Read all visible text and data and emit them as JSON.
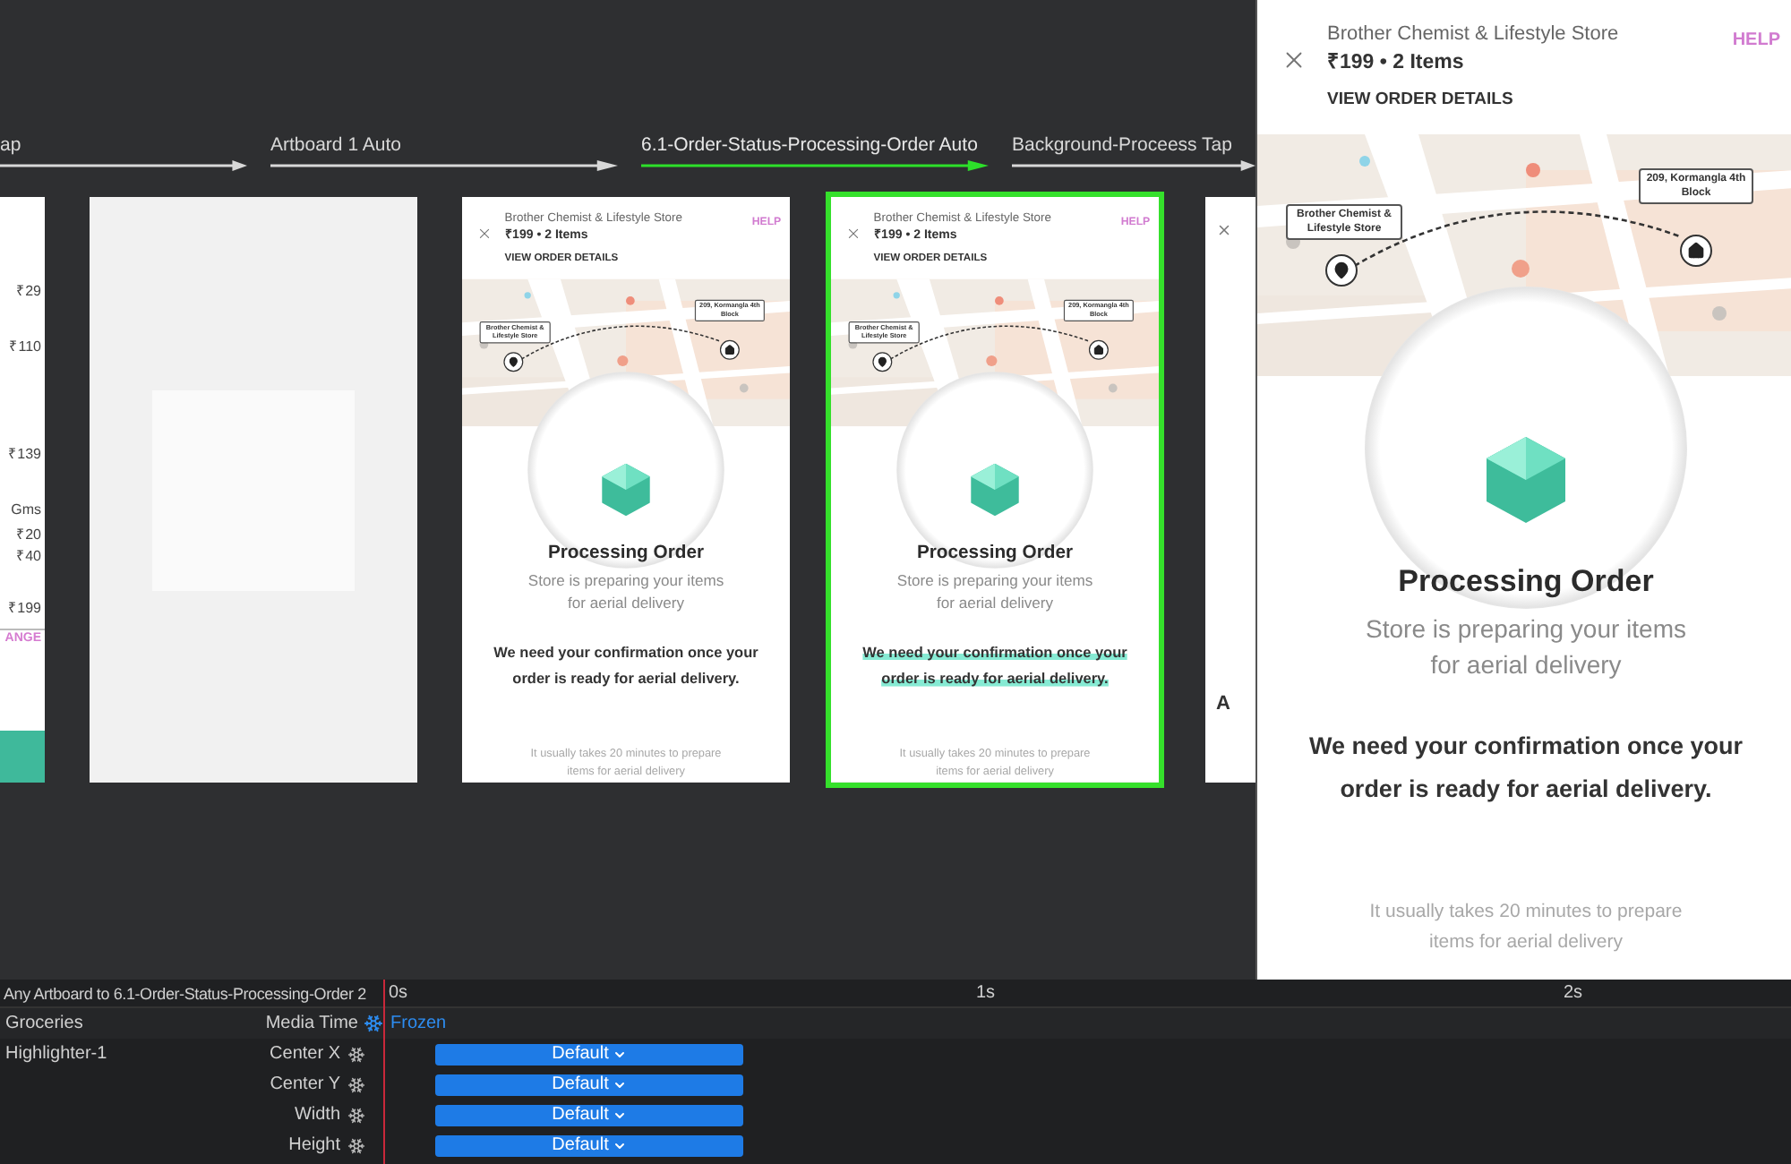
{
  "connections": [
    {
      "label": "ap",
      "selected": false
    },
    {
      "label": "Artboard 1 Auto",
      "selected": false
    },
    {
      "label": "6.1-Order-Status-Processing-Order Auto",
      "selected": true
    },
    {
      "label": "Background-Proceess Tap",
      "selected": false
    }
  ],
  "artboards": [
    {
      "kind": "prices",
      "selected": false,
      "prices": [
        "₹29",
        "₹110",
        "₹139",
        "Gms",
        "₹20",
        "₹40",
        "₹199"
      ],
      "action": "ANGE"
    },
    {
      "kind": "blank",
      "selected": false
    },
    {
      "kind": "order",
      "selected": false,
      "highlighter": false,
      "screen": {
        "store": "Brother Chemist & Lifestyle Store",
        "summary": "₹199 • 2 Items",
        "details_link": "VIEW ORDER DETAILS",
        "help": "HELP",
        "store_callout": "Brother Chemist & Lifestyle Store",
        "home_callout": "209, Kormangla 4th Block",
        "title": "Processing Order",
        "subtitle": "Store is preparing your items for aerial delivery",
        "confirmation": "We need your confirmation once your order is ready for aerial delivery.",
        "note": "It usually takes 20 minutes to prepare items for aerial delivery"
      }
    },
    {
      "kind": "order",
      "selected": true,
      "highlighter": true,
      "screen": {
        "store": "Brother Chemist & Lifestyle Store",
        "summary": "₹199 • 2 Items",
        "details_link": "VIEW ORDER DETAILS",
        "help": "HELP",
        "store_callout": "Brother Chemist & Lifestyle Store",
        "home_callout": "209, Kormangla 4th Block",
        "title": "Processing Order",
        "subtitle": "Store is preparing your items for aerial delivery",
        "confirmation": "We need your confirmation once your order is ready for aerial delivery.",
        "note": "It usually takes 20 minutes to prepare items for aerial delivery"
      }
    },
    {
      "kind": "clipped",
      "selected": false,
      "text": "A"
    }
  ],
  "preview": {
    "store": "Brother Chemist & Lifestyle Store",
    "summary": "₹199 • 2 Items",
    "details_link": "VIEW ORDER DETAILS",
    "help": "HELP",
    "store_callout": "Brother Chemist & Lifestyle Store",
    "home_callout": "209, Kormangla 4th Block",
    "title": "Processing Order",
    "subtitle": "Store is preparing your items for aerial delivery",
    "confirmation": "We need your confirmation once your order is ready for aerial delivery.",
    "note": "It usually takes 20 minutes to prepare items for aerial delivery"
  },
  "timeline": {
    "transition": "Any Artboard to 6.1-Order-Status-Processing-Order 2",
    "ticks": [
      "0s",
      "1s",
      "2s"
    ],
    "group": "Groceries",
    "media_label": "Media Time",
    "media_value": "Frozen",
    "layer": "Highlighter-1",
    "tracks": [
      {
        "property": "Center X",
        "bar": "Default"
      },
      {
        "property": "Center Y",
        "bar": "Default"
      },
      {
        "property": "Width",
        "bar": "Default"
      },
      {
        "property": "Height",
        "bar": "Default"
      }
    ]
  }
}
